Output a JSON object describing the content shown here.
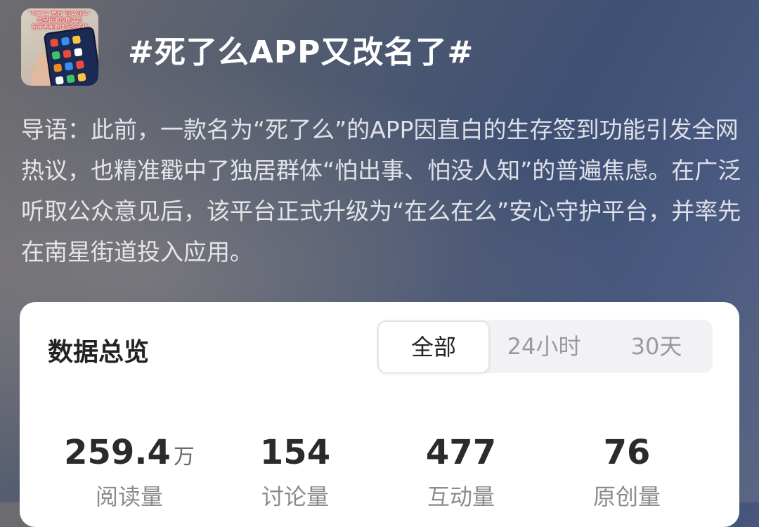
{
  "thumbnail": {
    "caption_line1": "“死了么”更名“在么在么”",
    "caption_line2": "南星街道投用试点",
    "caption_line3": "筑牢老年群体安全防线"
  },
  "topic": {
    "title": "#死了么APP又改名了#"
  },
  "intro": {
    "text": "导语：此前，一款名为“死了么”的APP因直白的生存签到功能引发全网热议，也精准戳中了独居群体“怕出事、怕没人知”的普遍焦虑。在广泛听取公众意见后，该平台正式升级为“在么在么”安心守护平台，并率先在南星街道投入应用。"
  },
  "overview": {
    "title": "数据总览",
    "tabs": [
      {
        "label": "全部",
        "active": true
      },
      {
        "label": "24小时",
        "active": false
      },
      {
        "label": "30天",
        "active": false
      }
    ],
    "stats": [
      {
        "value": "259.4",
        "unit": "万",
        "label": "阅读量"
      },
      {
        "value": "154",
        "unit": "",
        "label": "讨论量"
      },
      {
        "value": "477",
        "unit": "",
        "label": "互动量"
      },
      {
        "value": "76",
        "unit": "",
        "label": "原创量"
      }
    ]
  }
}
